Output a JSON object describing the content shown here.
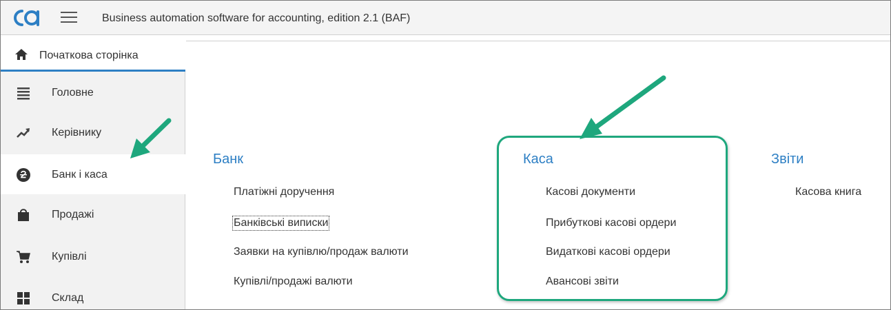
{
  "header": {
    "title": "Business automation software for accounting, edition 2.1  (BAF)"
  },
  "sidebar": {
    "home": "Початкова сторінка",
    "items": [
      {
        "label": "Головне",
        "icon": "list-icon"
      },
      {
        "label": "Керівнику",
        "icon": "trend-icon"
      },
      {
        "label": "Банк і каса",
        "icon": "currency-icon"
      },
      {
        "label": "Продажі",
        "icon": "shopping-bag-icon"
      },
      {
        "label": "Купівлі",
        "icon": "cart-icon"
      },
      {
        "label": "Склад",
        "icon": "grid-icon"
      }
    ],
    "active_index": 2
  },
  "main": {
    "bank": {
      "title": "Банк",
      "links": [
        "Платіжні доручення",
        "Банківські виписки",
        "Заявки на купівлю/продаж валюти",
        "Купівлі/продажі валюти"
      ]
    },
    "cash": {
      "title": "Каса",
      "links": [
        "Касові документи",
        "Прибуткові касові ордери",
        "Видаткові касові ордери",
        "Авансові звіти"
      ]
    },
    "reports": {
      "title": "Звіти",
      "links": [
        "Касова книга"
      ]
    }
  },
  "colors": {
    "accent": "#2d7fc4",
    "annotation": "#1ea77d"
  }
}
